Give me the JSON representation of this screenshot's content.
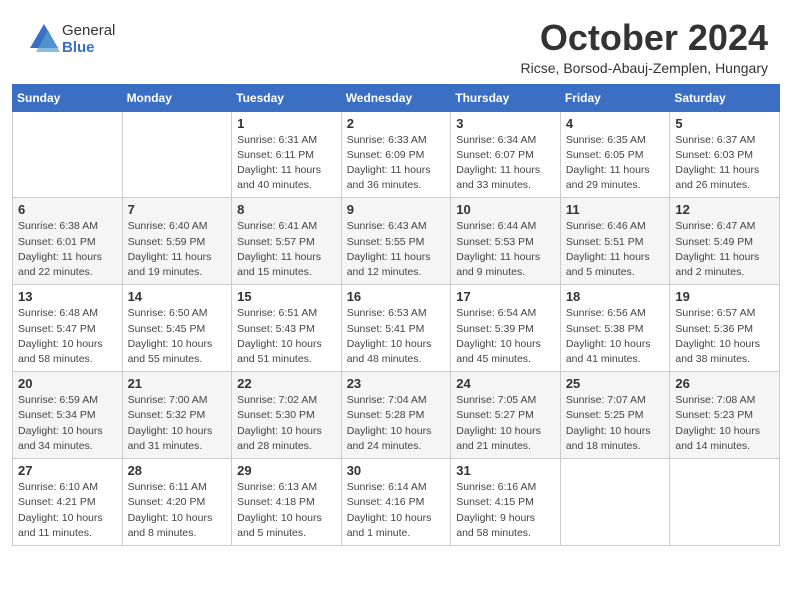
{
  "logo": {
    "general": "General",
    "blue": "Blue"
  },
  "header": {
    "month": "October 2024",
    "location": "Ricse, Borsod-Abauj-Zemplen, Hungary"
  },
  "weekdays": [
    "Sunday",
    "Monday",
    "Tuesday",
    "Wednesday",
    "Thursday",
    "Friday",
    "Saturday"
  ],
  "weeks": [
    [
      {
        "day": "",
        "info": ""
      },
      {
        "day": "",
        "info": ""
      },
      {
        "day": "1",
        "info": "Sunrise: 6:31 AM\nSunset: 6:11 PM\nDaylight: 11 hours and 40 minutes."
      },
      {
        "day": "2",
        "info": "Sunrise: 6:33 AM\nSunset: 6:09 PM\nDaylight: 11 hours and 36 minutes."
      },
      {
        "day": "3",
        "info": "Sunrise: 6:34 AM\nSunset: 6:07 PM\nDaylight: 11 hours and 33 minutes."
      },
      {
        "day": "4",
        "info": "Sunrise: 6:35 AM\nSunset: 6:05 PM\nDaylight: 11 hours and 29 minutes."
      },
      {
        "day": "5",
        "info": "Sunrise: 6:37 AM\nSunset: 6:03 PM\nDaylight: 11 hours and 26 minutes."
      }
    ],
    [
      {
        "day": "6",
        "info": "Sunrise: 6:38 AM\nSunset: 6:01 PM\nDaylight: 11 hours and 22 minutes."
      },
      {
        "day": "7",
        "info": "Sunrise: 6:40 AM\nSunset: 5:59 PM\nDaylight: 11 hours and 19 minutes."
      },
      {
        "day": "8",
        "info": "Sunrise: 6:41 AM\nSunset: 5:57 PM\nDaylight: 11 hours and 15 minutes."
      },
      {
        "day": "9",
        "info": "Sunrise: 6:43 AM\nSunset: 5:55 PM\nDaylight: 11 hours and 12 minutes."
      },
      {
        "day": "10",
        "info": "Sunrise: 6:44 AM\nSunset: 5:53 PM\nDaylight: 11 hours and 9 minutes."
      },
      {
        "day": "11",
        "info": "Sunrise: 6:46 AM\nSunset: 5:51 PM\nDaylight: 11 hours and 5 minutes."
      },
      {
        "day": "12",
        "info": "Sunrise: 6:47 AM\nSunset: 5:49 PM\nDaylight: 11 hours and 2 minutes."
      }
    ],
    [
      {
        "day": "13",
        "info": "Sunrise: 6:48 AM\nSunset: 5:47 PM\nDaylight: 10 hours and 58 minutes."
      },
      {
        "day": "14",
        "info": "Sunrise: 6:50 AM\nSunset: 5:45 PM\nDaylight: 10 hours and 55 minutes."
      },
      {
        "day": "15",
        "info": "Sunrise: 6:51 AM\nSunset: 5:43 PM\nDaylight: 10 hours and 51 minutes."
      },
      {
        "day": "16",
        "info": "Sunrise: 6:53 AM\nSunset: 5:41 PM\nDaylight: 10 hours and 48 minutes."
      },
      {
        "day": "17",
        "info": "Sunrise: 6:54 AM\nSunset: 5:39 PM\nDaylight: 10 hours and 45 minutes."
      },
      {
        "day": "18",
        "info": "Sunrise: 6:56 AM\nSunset: 5:38 PM\nDaylight: 10 hours and 41 minutes."
      },
      {
        "day": "19",
        "info": "Sunrise: 6:57 AM\nSunset: 5:36 PM\nDaylight: 10 hours and 38 minutes."
      }
    ],
    [
      {
        "day": "20",
        "info": "Sunrise: 6:59 AM\nSunset: 5:34 PM\nDaylight: 10 hours and 34 minutes."
      },
      {
        "day": "21",
        "info": "Sunrise: 7:00 AM\nSunset: 5:32 PM\nDaylight: 10 hours and 31 minutes."
      },
      {
        "day": "22",
        "info": "Sunrise: 7:02 AM\nSunset: 5:30 PM\nDaylight: 10 hours and 28 minutes."
      },
      {
        "day": "23",
        "info": "Sunrise: 7:04 AM\nSunset: 5:28 PM\nDaylight: 10 hours and 24 minutes."
      },
      {
        "day": "24",
        "info": "Sunrise: 7:05 AM\nSunset: 5:27 PM\nDaylight: 10 hours and 21 minutes."
      },
      {
        "day": "25",
        "info": "Sunrise: 7:07 AM\nSunset: 5:25 PM\nDaylight: 10 hours and 18 minutes."
      },
      {
        "day": "26",
        "info": "Sunrise: 7:08 AM\nSunset: 5:23 PM\nDaylight: 10 hours and 14 minutes."
      }
    ],
    [
      {
        "day": "27",
        "info": "Sunrise: 6:10 AM\nSunset: 4:21 PM\nDaylight: 10 hours and 11 minutes."
      },
      {
        "day": "28",
        "info": "Sunrise: 6:11 AM\nSunset: 4:20 PM\nDaylight: 10 hours and 8 minutes."
      },
      {
        "day": "29",
        "info": "Sunrise: 6:13 AM\nSunset: 4:18 PM\nDaylight: 10 hours and 5 minutes."
      },
      {
        "day": "30",
        "info": "Sunrise: 6:14 AM\nSunset: 4:16 PM\nDaylight: 10 hours and 1 minute."
      },
      {
        "day": "31",
        "info": "Sunrise: 6:16 AM\nSunset: 4:15 PM\nDaylight: 9 hours and 58 minutes."
      },
      {
        "day": "",
        "info": ""
      },
      {
        "day": "",
        "info": ""
      }
    ]
  ]
}
